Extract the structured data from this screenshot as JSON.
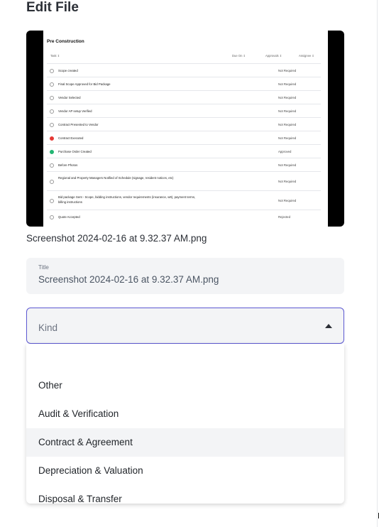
{
  "page": {
    "title": "Edit File"
  },
  "preview": {
    "sheet_title": "Pre Construction",
    "headers": {
      "task": "Task ⇕",
      "due_on": "Due On ⇕",
      "approvals": "Approvals ⇕",
      "assignee": "Assignee ⇕"
    },
    "rows": [
      {
        "task": "Scope created",
        "status": "Not Required",
        "icon": "check-circle-icon"
      },
      {
        "task": "Final Scope Approved for Bid Package",
        "status": "Not Required",
        "icon": "check-circle-icon"
      },
      {
        "task": "Vendor Selected",
        "status": "Not Required",
        "icon": "check-circle-icon"
      },
      {
        "task": "Vendor AP setup Verified",
        "status": "Not Required",
        "icon": "check-circle-icon"
      },
      {
        "task": "Contract Presented to Vendor",
        "status": "Not Required",
        "icon": "check-circle-icon"
      },
      {
        "task": "Contract Executed",
        "status": "Not Required",
        "icon": "error-circle-icon"
      },
      {
        "task": "Purchase Order Created",
        "status": "Approved",
        "icon": "done-circle-icon"
      },
      {
        "task": "Before Photos",
        "status": "Not Required",
        "icon": "check-circle-icon"
      },
      {
        "task": "Regional and Property Managers Notified of Schedule (signage, resident notices, etc)",
        "status": "Not Required",
        "icon": "check-circle-icon"
      },
      {
        "task": "Bid package Sent - Scope, bidding instructions, vendor requirements (insurance, w9), payment terms, billing instructions",
        "status": "Not Required",
        "icon": "check-circle-icon"
      },
      {
        "task": "Quote Accepted",
        "status": "Rejected",
        "icon": "check-circle-icon"
      }
    ]
  },
  "file": {
    "caption": "Screenshot 2024-02-16 at 9.32.37 AM.png"
  },
  "title_field": {
    "label": "Title",
    "value": "Screenshot 2024-02-16 at 9.32.37 AM.png"
  },
  "kind_field": {
    "placeholder": "Kind",
    "icon": "caret-up-icon"
  },
  "kind_options": [
    "Other",
    "Audit & Verification",
    "Contract & Agreement",
    "Depreciation & Valuation",
    "Disposal & Transfer"
  ],
  "colors": {
    "accent": "#5b57d1",
    "error": "#e53935",
    "success": "#22b573",
    "field_bg": "#f3f4f6"
  }
}
